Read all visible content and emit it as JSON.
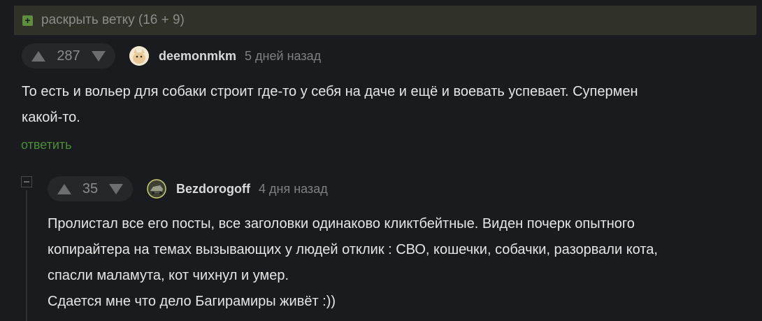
{
  "expand": {
    "label": "раскрыть ветку (16 + 9)",
    "icon": "plus-square-icon",
    "accent": "#5c8f3e"
  },
  "comment1": {
    "rating": "287",
    "author": "deemonmkm",
    "time": "5 дней назад",
    "lines": [
      "То есть и вольер для собаки строит где-то у себя на даче и ещё и воевать успевает. Супермен",
      "какой-то."
    ],
    "reply": "ответить",
    "avatar_icon": "cat-avatar-icon"
  },
  "comment2": {
    "rating": "35",
    "author": "Bezdorogoff",
    "time": "4 дня назад",
    "lines": [
      "Пролистал все его посты, все заголовки одинаково кликтбейтные. Виден почерк опытного",
      "копирайтера на темах вызывающих у людей отклик : СВО, кошечки, собачки, разорвали кота,",
      "спасли маламута, кот чихнул и умер.",
      "Сдается мне что дело Багирамиры живёт :))"
    ],
    "avatar_icon": "car-avatar-icon"
  },
  "colors": {
    "background": "#1a1b1e",
    "link": "#4b8e3a",
    "text": "#e6e6e6"
  }
}
